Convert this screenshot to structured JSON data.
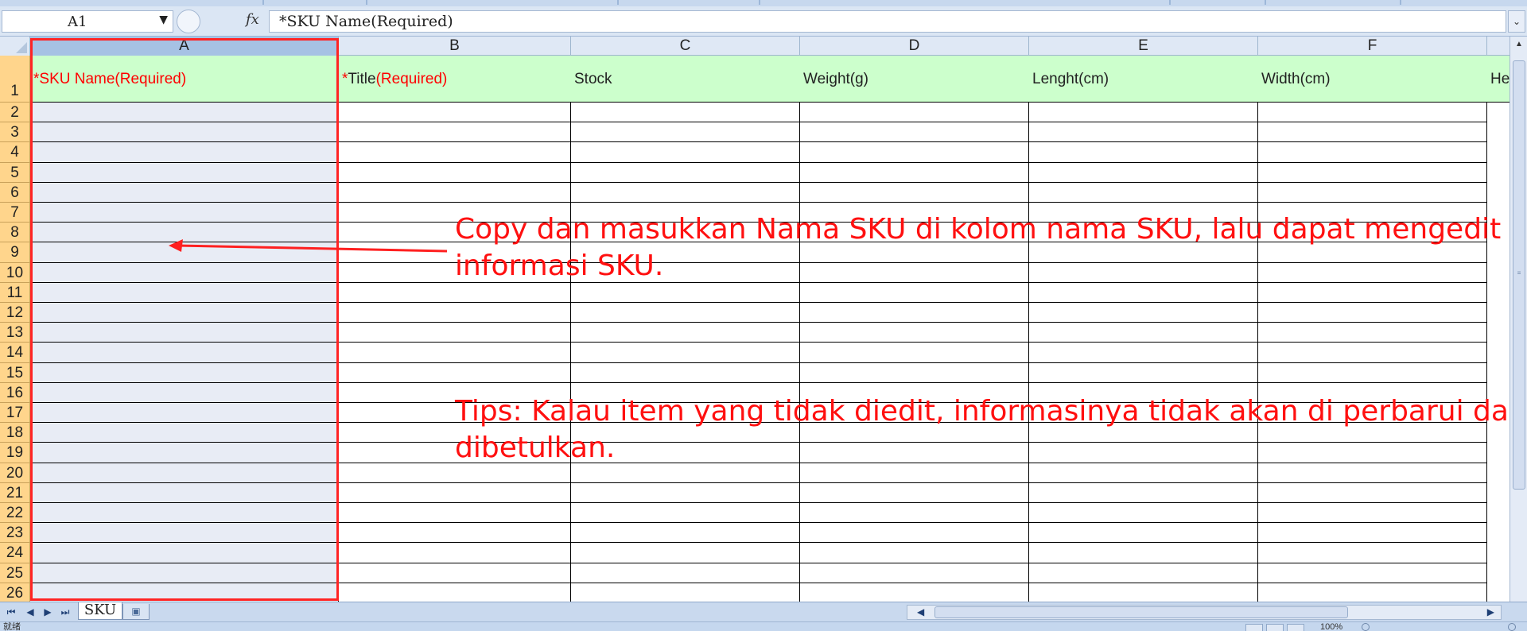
{
  "formula_bar": {
    "name_box": "A1",
    "fx_label": "fx",
    "formula": "*SKU Name(Required)"
  },
  "columns": [
    "A",
    "B",
    "C",
    "D",
    "E",
    "F"
  ],
  "rows": [
    "1",
    "2",
    "3",
    "4",
    "5",
    "6",
    "7",
    "8",
    "9",
    "10",
    "11",
    "12",
    "13",
    "14",
    "15",
    "16",
    "17",
    "18",
    "19",
    "20",
    "21",
    "22",
    "23",
    "24",
    "25",
    "26"
  ],
  "header_cells": {
    "a": {
      "marker": "*",
      "label": "SKU Name(Required)"
    },
    "b": {
      "marker": "*",
      "label": "Title",
      "required": "(Required)"
    },
    "c": "Stock",
    "d": "Weight(g)",
    "e": "Lenght(cm)",
    "f": "Width(cm)",
    "g": "He"
  },
  "annotations": {
    "note_1_line_1": "Copy dan masukkan Nama SKU di kolom nama SKU, lalu dapat mengedit",
    "note_1_line_2": "informasi SKU.",
    "note_2_line_1": "Tips: Kalau item yang tidak diedit, informasinya tidak akan di perbarui dan",
    "note_2_line_2": "dibetulkan."
  },
  "sheet_tabs": {
    "active": "SKU"
  },
  "status_bar": {
    "status": "就绪",
    "zoom": "100%"
  },
  "colors": {
    "header_fill": "#ccffcc",
    "column_a_fill": "#e8ecf5",
    "annotation_red": "#ff1010",
    "row_header_fill": "#ffd58c"
  }
}
